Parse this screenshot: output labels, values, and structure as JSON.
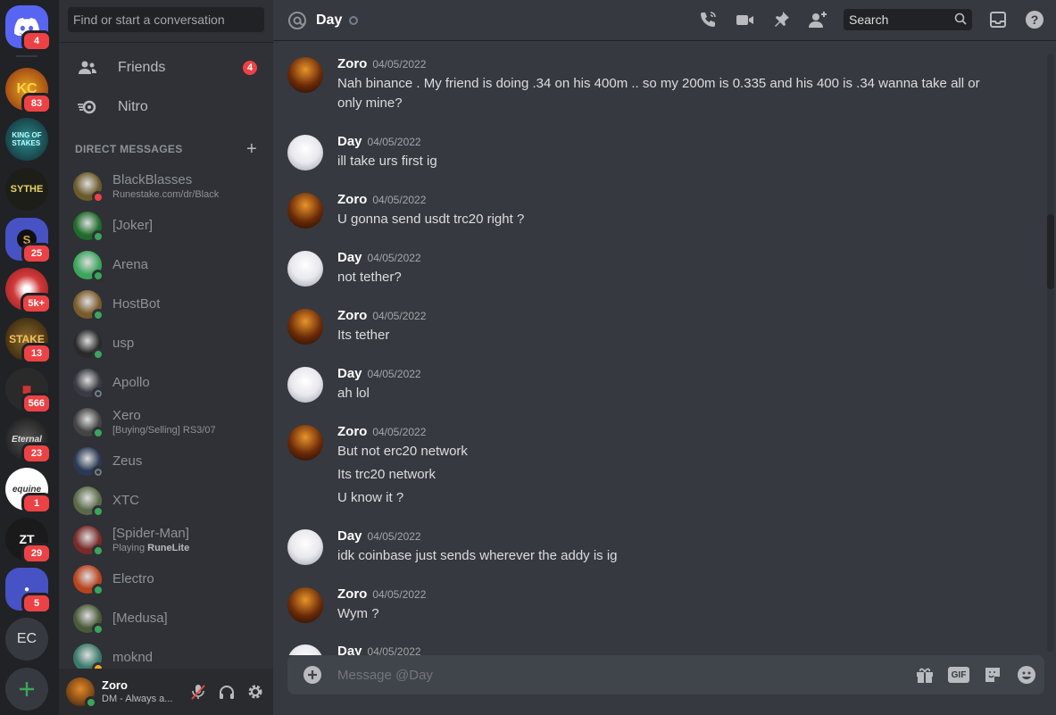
{
  "servers": [
    {
      "name": "home",
      "badge": "4",
      "color": "#5865f2"
    },
    {
      "name": "KC",
      "badge": "83",
      "color": "#8a2a10"
    },
    {
      "name": "King of Stakes",
      "badge": "",
      "color": "#1f5f66"
    },
    {
      "name": "Sythe",
      "badge": "",
      "color": "#2a2a22"
    },
    {
      "name": "S",
      "badge": "25",
      "color": "#4752c4"
    },
    {
      "name": "red",
      "badge": "5k+",
      "color": "#c23a2a"
    },
    {
      "name": "Stake",
      "badge": "13",
      "color": "#5a3a10"
    },
    {
      "name": "ninja",
      "badge": "566",
      "color": "#333"
    },
    {
      "name": "Eternal",
      "badge": "23",
      "color": "#3a3a3a"
    },
    {
      "name": "equine",
      "badge": "1",
      "color": "#ffffff"
    },
    {
      "name": "ZT",
      "badge": "29",
      "color": "#1a1a1a"
    },
    {
      "name": "blue",
      "badge": "5",
      "color": "#4752c4"
    },
    {
      "name": "EC",
      "badge": "",
      "color": "#36393f"
    }
  ],
  "sidebar": {
    "search_placeholder": "Find or start a conversation",
    "friends_label": "Friends",
    "friends_badge": "4",
    "nitro_label": "Nitro",
    "dm_heading": "DIRECT MESSAGES",
    "dms": [
      {
        "name": "BlackBlasses",
        "sub": "Runestake.com/dr/Black",
        "status": "dnd",
        "color": "#6b5a2a"
      },
      {
        "name": "[Joker]",
        "sub": "",
        "status": "online",
        "color": "#1f6b2a"
      },
      {
        "name": "Arena",
        "sub": "",
        "status": "online",
        "color": "#3ba55c"
      },
      {
        "name": "HostBot",
        "sub": "",
        "status": "online",
        "color": "#7a5a2a"
      },
      {
        "name": "usp",
        "sub": "",
        "status": "online",
        "color": "#2a2a2a"
      },
      {
        "name": "Apollo",
        "sub": "",
        "status": "offline",
        "color": "#3a3a44"
      },
      {
        "name": "Xero",
        "sub": "[Buying/Selling] RS3/07",
        "status": "online",
        "color": "#444"
      },
      {
        "name": "Zeus",
        "sub": "",
        "status": "offline",
        "color": "#2a3a55"
      },
      {
        "name": "XTC",
        "sub": "",
        "status": "online",
        "color": "#5a6a4a"
      },
      {
        "name": "[Spider-Man]",
        "sub_prefix": "Playing ",
        "sub_bold": "RuneLite",
        "status": "online",
        "color": "#7a2a2a"
      },
      {
        "name": "Electro",
        "sub": "",
        "status": "online",
        "color": "#b8431f"
      },
      {
        "name": "[Medusa]",
        "sub": "",
        "status": "online",
        "color": "#4a5a3a"
      },
      {
        "name": "moknd",
        "sub": "",
        "status": "idle",
        "color": "#3a7a6a"
      }
    ],
    "user": {
      "name": "Zoro",
      "status": "DM - Always a..."
    }
  },
  "chat": {
    "title": "Day",
    "search_label": "Search",
    "composer_placeholder": "Message @Day",
    "messages": [
      {
        "author": "Zoro",
        "time": "04/05/2022",
        "lines": [
          "Nah binance . My friend is doing .34 on his 400m .. so my 200m is 0.335 and his 400 is .34 wanna take all or",
          "only mine?"
        ]
      },
      {
        "author": "Day",
        "time": "04/05/2022",
        "lines": [
          "ill take urs first ig"
        ]
      },
      {
        "author": "Zoro",
        "time": "04/05/2022",
        "lines": [
          "U gonna send usdt trc20 right ?"
        ]
      },
      {
        "author": "Day",
        "time": "04/05/2022",
        "lines": [
          "not tether?"
        ]
      },
      {
        "author": "Zoro",
        "time": "04/05/2022",
        "lines": [
          "Its tether"
        ]
      },
      {
        "author": "Day",
        "time": "04/05/2022",
        "lines": [
          "ah lol"
        ]
      },
      {
        "author": "Zoro",
        "time": "04/05/2022",
        "lines": [
          "But not erc20 network",
          "Its trc20 network",
          "U know it ?"
        ]
      },
      {
        "author": "Day",
        "time": "04/05/2022",
        "lines": [
          "idk coinbase just sends wherever the addy is ig"
        ]
      },
      {
        "author": "Zoro",
        "time": "04/05/2022",
        "lines": [
          "Wym ?"
        ]
      },
      {
        "author": "Day",
        "time": "04/05/2022",
        "lines": []
      }
    ]
  }
}
